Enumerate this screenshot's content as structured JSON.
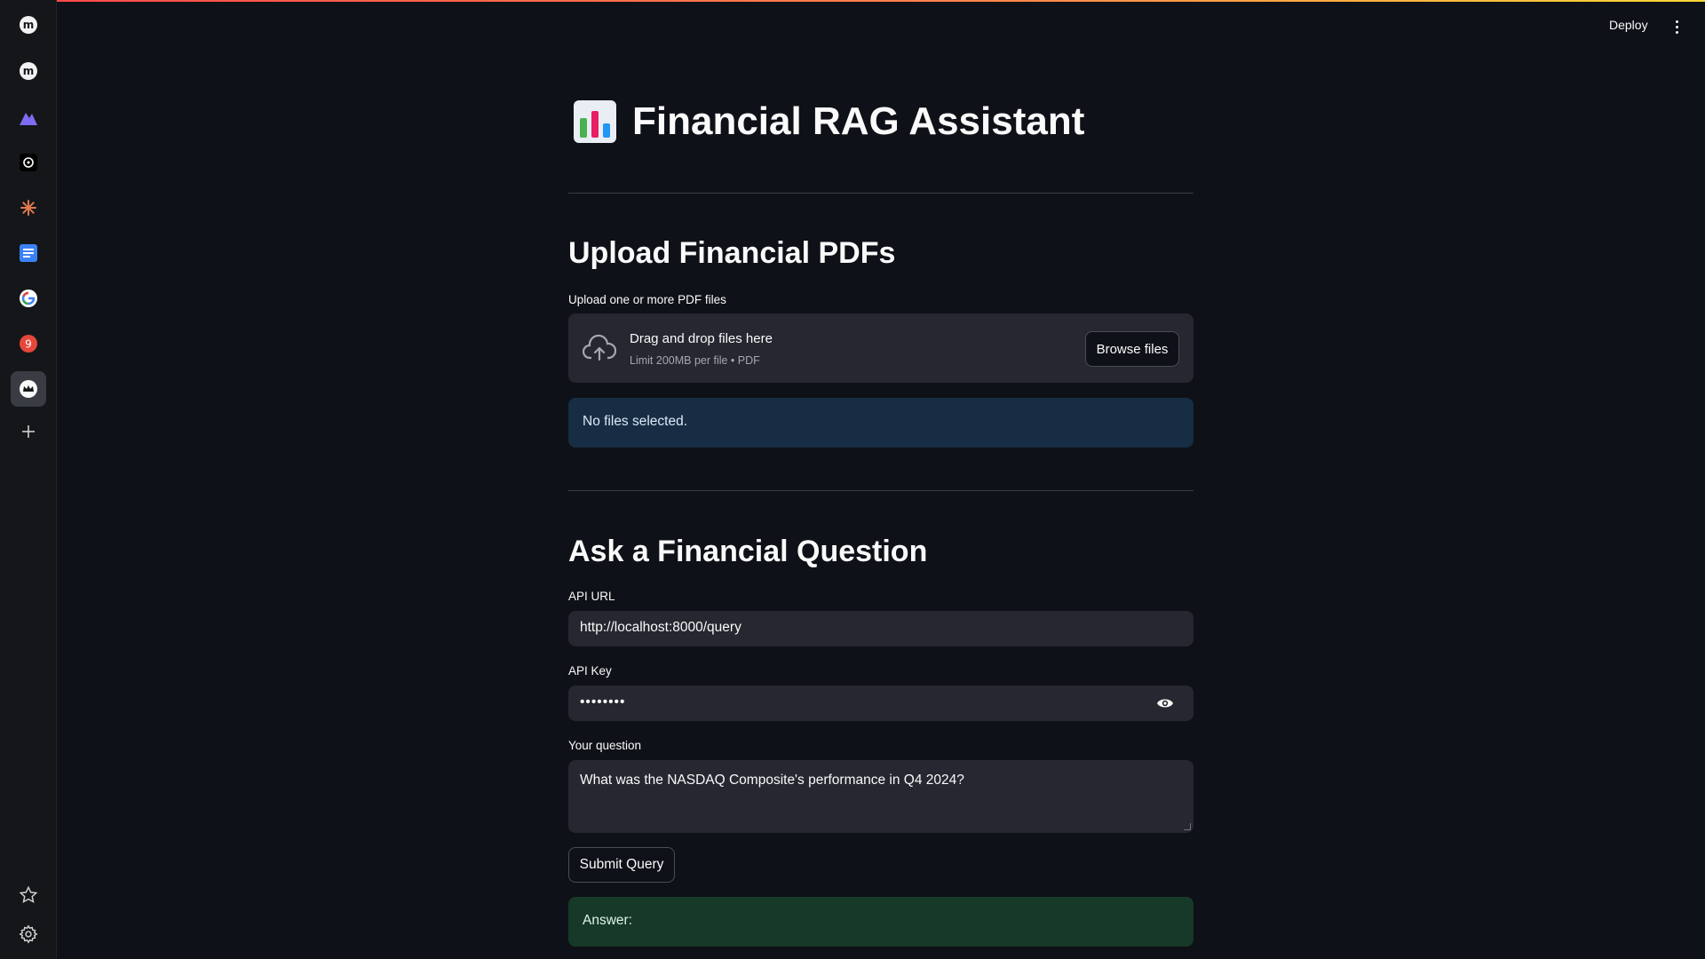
{
  "sidebar": {
    "items": [
      {
        "name": "m-app-icon",
        "letter": "m"
      },
      {
        "name": "m-app-icon-2",
        "letter": "m"
      },
      {
        "name": "mountain-icon"
      },
      {
        "name": "openai-icon"
      },
      {
        "name": "claude-icon"
      },
      {
        "name": "docs-icon"
      },
      {
        "name": "google-icon"
      },
      {
        "name": "badge-icon",
        "badge": "9"
      },
      {
        "name": "crown-icon",
        "active": true
      },
      {
        "name": "plus-icon"
      }
    ],
    "bottom": [
      {
        "name": "star-icon"
      },
      {
        "name": "settings-icon"
      }
    ]
  },
  "header": {
    "deploy_label": "Deploy"
  },
  "main": {
    "title": "Financial RAG Assistant",
    "title_icon": "bar-chart-emoji",
    "upload_section": {
      "heading": "Upload Financial PDFs",
      "uploader_label": "Upload one or more PDF files",
      "dropzone_title": "Drag and drop files here",
      "dropzone_limit": "Limit 200MB per file • PDF",
      "browse_label": "Browse files",
      "info_message": "No files selected."
    },
    "query_section": {
      "heading": "Ask a Financial Question",
      "api_url_label": "API URL",
      "api_url_value": "http://localhost:8000/query",
      "api_key_label": "API Key",
      "api_key_value": "••••••••",
      "question_label": "Your question",
      "question_value": "What was the NASDAQ Composite's performance in Q4 2024?",
      "submit_label": "Submit Query",
      "answer_label": "Answer:"
    }
  },
  "colors": {
    "background": "#0e1117",
    "input_bg": "#262730",
    "info_bg": "#172d43",
    "success_bg": "#173928",
    "accent": "#ff4b4b"
  }
}
